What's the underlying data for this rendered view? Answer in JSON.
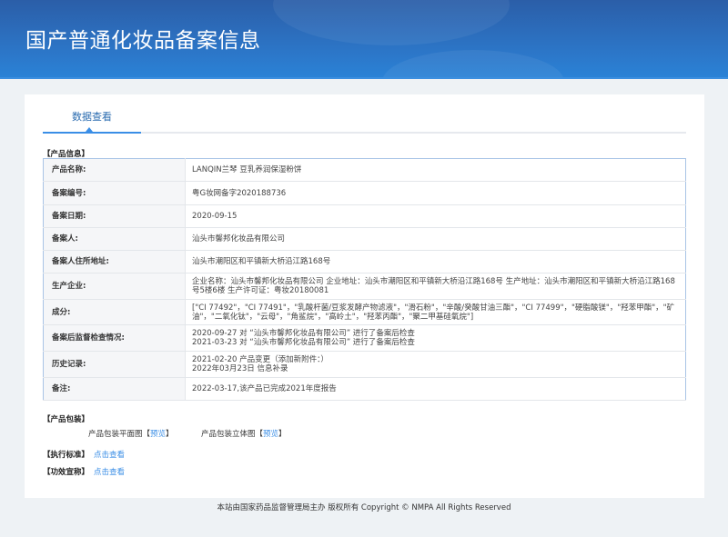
{
  "header": {
    "title": "国产普通化妆品备案信息"
  },
  "tabs": [
    {
      "label": "数据查看"
    }
  ],
  "product_info": {
    "section_title": "【产品信息】",
    "rows": [
      {
        "label": "产品名称:",
        "value": "LANQIN兰琴 豆乳养润保湿粉饼"
      },
      {
        "label": "备案编号:",
        "value": "粤G妆网备字2020188736"
      },
      {
        "label": "备案日期:",
        "value": "2020-09-15"
      },
      {
        "label": "备案人:",
        "value": "汕头市馨邦化妆品有限公司"
      },
      {
        "label": "备案人住所地址:",
        "value": "汕头市潮阳区和平镇新大桥沿江路168号"
      },
      {
        "label": "生产企业:",
        "value": "企业名称：汕头市馨邦化妆品有限公司 企业地址：汕头市潮阳区和平镇新大桥沿江路168号 生产地址：汕头市潮阳区和平镇新大桥沿江路168 号5楼6楼 生产许可证：粤妆20180081"
      },
      {
        "label": "成分:",
        "value": "[\"CI 77492\"，\"CI 77491\"，\"乳酸杆菌/豆浆发酵产物滤液\"，\"滑石粉\"，\"辛酸/癸酸甘油三酯\"，\"CI 77499\"，\"硬脂酸镁\"，\"羟苯甲酯\"，\"矿油\"，\"二氧化钛\"，\"云母\"，\"角鲨烷\"，\"高岭土\"，\"羟苯丙酯\"，\"聚二甲基硅氧烷\"]"
      },
      {
        "label": "备案后监督检查情况:",
        "lines": [
          "2020-09-27 对 “汕头市馨邦化妆品有限公司” 进行了备案后检查",
          "2021-03-23 对 “汕头市馨邦化妆品有限公司” 进行了备案后检查"
        ]
      },
      {
        "label": "历史记录:",
        "lines": [
          "2021-02-20 产品变更（添加新附件：）",
          "2022年03月23日 信息补录"
        ]
      },
      {
        "label": "备注:",
        "value": "2022-03-17,该产品已完成2021年度报告"
      }
    ]
  },
  "packaging": {
    "section_title": "【产品包装】",
    "flat_label": "产品包装平面图",
    "solid_label": "产品包装立体图",
    "preview": "预览",
    "lb": "【",
    "rb": "】"
  },
  "standard": {
    "section_title": "【执行标准】",
    "link": "点击查看"
  },
  "efficacy": {
    "section_title": "【功效宣称】",
    "link": "点击查看"
  },
  "footer": {
    "text": "本站由国家药品监督管理局主办 版权所有 Copyright © NMPA All Rights Reserved"
  }
}
